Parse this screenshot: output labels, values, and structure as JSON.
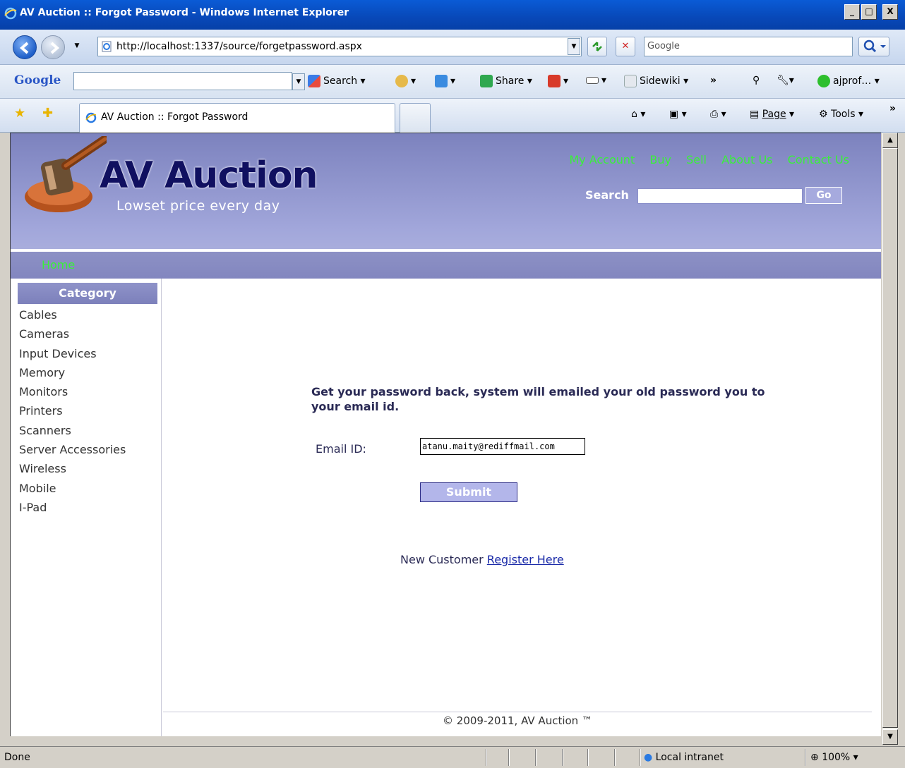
{
  "window": {
    "title": "AV Auction :: Forgot Password - Windows Internet Explorer",
    "minimize": "_",
    "maximize": "□",
    "close": "X"
  },
  "navigation": {
    "address": "http://localhost:1337/source/forgetpassword.aspx",
    "search_placeholder": "Google"
  },
  "google_toolbar": {
    "logo": "Google",
    "search_label": "Search",
    "share_label": "Share",
    "sidewiki_label": "Sidewiki",
    "more": "»",
    "account": "ajprof…"
  },
  "tab": {
    "title": "AV Auction :: Forgot Password"
  },
  "commands": {
    "page_label": "Page",
    "tools_label": "Tools",
    "more": "»"
  },
  "site": {
    "brand": "AV Auction",
    "tagline": "Lowset price every day",
    "top_links": [
      "My Account",
      "Buy",
      "Sell",
      "About Us",
      "Contact Us"
    ],
    "search_label": "Search",
    "search_button": "Go",
    "menu_home": "Home",
    "category_heading": "Category",
    "categories": [
      "Cables",
      "Cameras",
      "Input Devices",
      "Memory",
      "Monitors",
      "Printers",
      "Scanners",
      "Server Accessories",
      "Wireless",
      "Mobile",
      "I-Pad"
    ],
    "intro_text": "Get your password back, system will emailed your old password you to your email id.",
    "email_label": "Email ID:",
    "email_value": "atanu.maity@rediffmail.com",
    "submit_label": "Submit",
    "new_customer_text": "New Customer",
    "register_link": "Register Here",
    "footer": "© 2009-2011, AV Auction ™"
  },
  "status": {
    "text": "Done",
    "zone": "Local intranet",
    "zoom": "100%"
  },
  "colors": {
    "header": "#8e93cc",
    "nav_link": "#39f039",
    "submit": "#b3b6ea"
  }
}
